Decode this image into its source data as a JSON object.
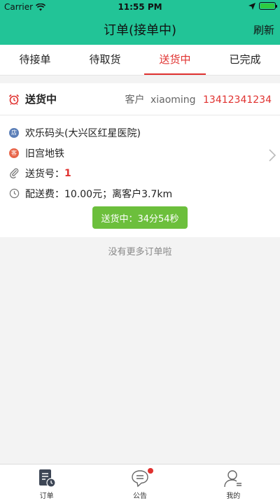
{
  "status_bar": {
    "carrier": "Carrier",
    "time": "11:55 PM"
  },
  "nav": {
    "title": "订单(接单中)",
    "refresh_label": "刷新"
  },
  "tabs": [
    {
      "label": "待接单",
      "active": false
    },
    {
      "label": "待取货",
      "active": false
    },
    {
      "label": "送货中",
      "active": true
    },
    {
      "label": "已完成",
      "active": false
    }
  ],
  "order": {
    "status_title": "送货中",
    "customer_label": "客户",
    "customer_name": "xiaoming",
    "customer_phone": "13412341234",
    "store_icon_text": "店",
    "store_name": "欢乐码头(大兴区红星医院)",
    "customer_icon_text": "客",
    "destination": "旧宫地铁",
    "delivery_no_label": "送货号：",
    "delivery_no": "1",
    "fee_text": "配送费：10.00元；离客户3.7km",
    "status_button_label": "送货中：",
    "status_button_time": "34分54秒"
  },
  "no_more_text": "没有更多订单啦",
  "tabbar": [
    {
      "label": "订单"
    },
    {
      "label": "公告"
    },
    {
      "label": "我的"
    }
  ],
  "colors": {
    "brand": "#22c497",
    "accent": "#e0312f",
    "button": "#6cbf3c"
  }
}
